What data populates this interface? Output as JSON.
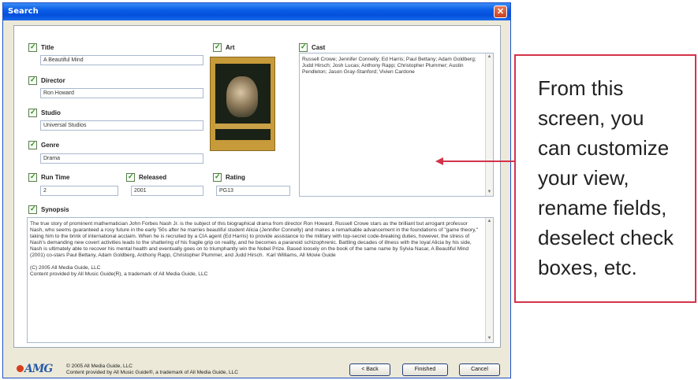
{
  "window": {
    "title": "Search",
    "close_label": "✕"
  },
  "fields": {
    "title": {
      "label": "Title",
      "value": "A Beautiful Mind"
    },
    "director": {
      "label": "Director",
      "value": "Ron Howard"
    },
    "studio": {
      "label": "Studio",
      "value": "Universal Studios"
    },
    "genre": {
      "label": "Genre",
      "value": "Drama"
    },
    "runtime": {
      "label": "Run Time",
      "value": "2"
    },
    "released": {
      "label": "Released",
      "value": "2001"
    },
    "rating": {
      "label": "Rating",
      "value": "PG13"
    },
    "art": {
      "label": "Art"
    },
    "cast": {
      "label": "Cast",
      "value": "Russell Crowe; Jennifer Connelly; Ed Harris; Paul Bettany; Adam Goldberg; Judd Hirsch; Josh Lucas; Anthony Rapp; Christopher Plummer; Austin Pendleton; Jason Gray-Stanford; Vivien Cardone"
    },
    "synopsis": {
      "label": "Synopsis",
      "value": "The true story of prominent mathematician John Forbes Nash Jr. is the subject of this biographical drama from director Ron Howard. Russell Crowe stars as the brilliant but arrogant professor Nash, who seems guaranteed a rosy future in the early '50s after he marries beautiful student Alicia (Jennifer Connelly) and makes a remarkable advancement in the foundations of \"game theory,\" taking him to the brink of international acclaim. When he is recruited by a CIA agent (Ed Harris) to provide assistance to the military with top-secret code-breaking duties, however, the stress of Nash's demanding new covert activities leads to the shattering of his fragile grip on reality, and he becomes a paranoid schizophrenic. Battling decades of illness with the loyal Alicia by his side, Nash is ultimately able to recover his mental health and eventually goes on to triumphantly win the Nobel Prize. Based loosely on the book of the same name by Sylvia Nasar, A Beautiful Mind (2001) co-stars Paul Bettany, Adam Goldberg, Anthony Rapp, Christopher Plummer, and Judd Hirsch.  Karl Williams, All Movie Guide\n\n(C) 2005 All Media Guide, LLC\nContent provided by All Music Guide(R), a trademark of All Media Guide, LLC"
    }
  },
  "footer": {
    "logo_text": "AMG",
    "copyright_line1": "© 2005 All Media Guide, LLC",
    "copyright_line2": "Content provided by All Music Guide®, a trademark of All Media Guide, LLC",
    "back_label": "< Back",
    "finished_label": "Finished",
    "cancel_label": "Cancel"
  },
  "callout": {
    "lines": [
      "From this",
      "screen, you",
      "can customize",
      "your view,",
      "rename fields,",
      "deselect check",
      "boxes, etc."
    ]
  },
  "colors": {
    "accent_red": "#d3334a",
    "titlebar_blue": "#0a5ee6",
    "checkbox_green": "#2f8b1f"
  },
  "icons": {
    "close": "close-icon",
    "check": "checkmark-icon",
    "arrow": "left-arrow-icon"
  }
}
